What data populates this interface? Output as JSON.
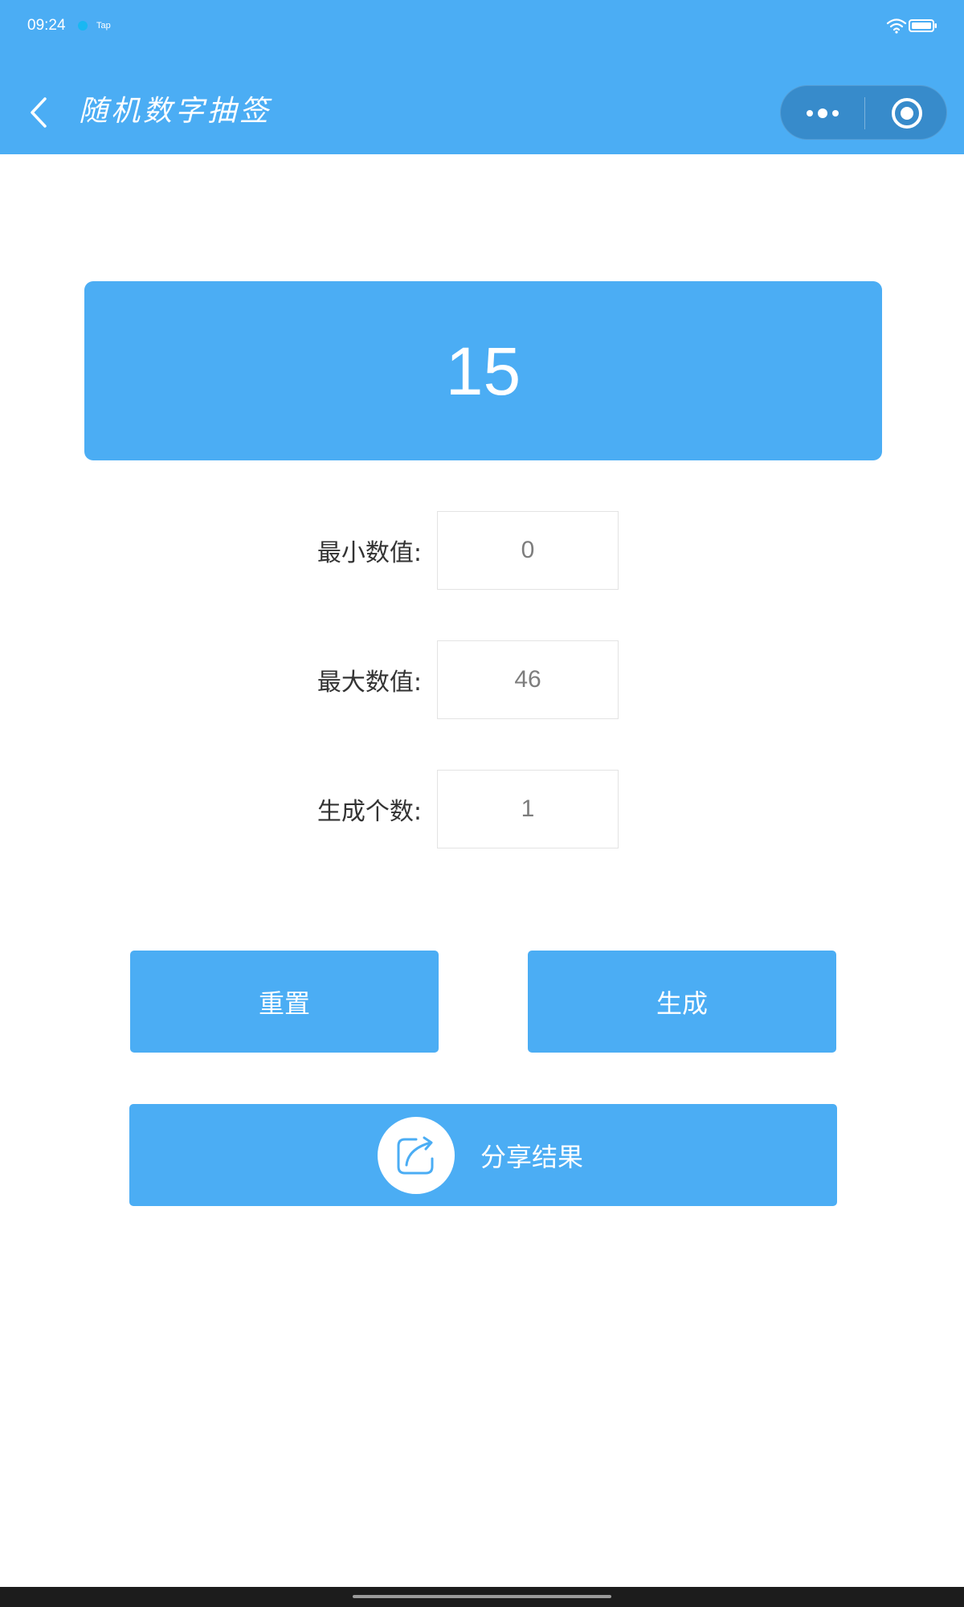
{
  "status_bar": {
    "time": "09:24",
    "tap_label": "Tap"
  },
  "nav": {
    "title": "随机数字抽签",
    "icons": {
      "back": "chevron-left-icon",
      "more": "more-dots-icon",
      "close": "target-circle-icon"
    }
  },
  "result": {
    "value": "15"
  },
  "form": {
    "min_label": "最小数值:",
    "min_value": "0",
    "max_label": "最大数值:",
    "max_value": "46",
    "count_label": "生成个数:",
    "count_value": "1"
  },
  "actions": {
    "reset_label": "重置",
    "generate_label": "生成",
    "share_label": "分享结果",
    "share_icon": "share-arrow-icon"
  },
  "colors": {
    "primary": "#4badf4",
    "background": "#ffffff",
    "label_text": "#333333",
    "input_text": "#7d7d7d"
  }
}
